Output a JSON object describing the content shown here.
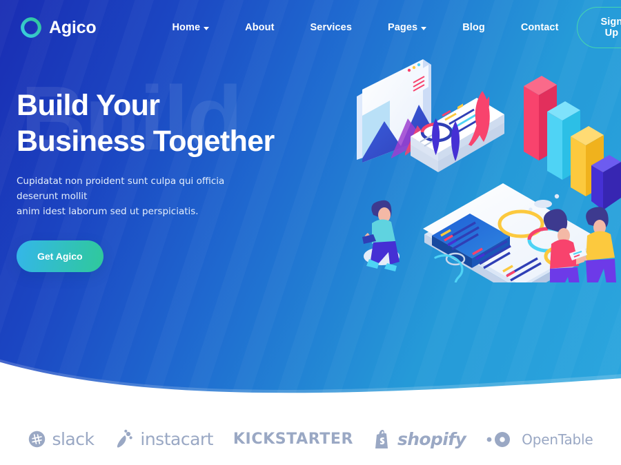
{
  "brand": {
    "name": "Agico",
    "logo_icon": "agico-ring-logo",
    "gradient_from": "#37c0e8",
    "gradient_to": "#2fc98e"
  },
  "nav": {
    "items": [
      {
        "label": "Home",
        "has_dropdown": true,
        "icon": "chevron-down-icon"
      },
      {
        "label": "About",
        "has_dropdown": false,
        "icon": ""
      },
      {
        "label": "Services",
        "has_dropdown": false,
        "icon": ""
      },
      {
        "label": "Pages",
        "has_dropdown": true,
        "icon": "chevron-down-icon"
      },
      {
        "label": "Blog",
        "has_dropdown": false,
        "icon": ""
      },
      {
        "label": "Contact",
        "has_dropdown": false,
        "icon": ""
      }
    ],
    "signup_label": "Sign Up",
    "signup_border_color": "#45d6ae"
  },
  "hero": {
    "watermark": "Build",
    "title": "Build Your\nBusiness Together",
    "subtitle": "Cupidatat non proident sunt culpa qui officia deserunt mollit\nanim idest laborum sed ut perspiciatis.",
    "cta_label": "Get Agico",
    "cta_gradient_from": "#34b6ea",
    "cta_gradient_to": "#2fc99a",
    "bg_gradient_from": "#1a2db3",
    "bg_gradient_to": "#2ba6de",
    "illustration": "isometric-business-analytics-illustration"
  },
  "logos": [
    {
      "name": "slack",
      "icon": "slack-icon",
      "word": "slack"
    },
    {
      "name": "instacart",
      "icon": "instacart-carrot-icon",
      "word": "instacart"
    },
    {
      "name": "kickstarter",
      "icon": "",
      "word": "KICKSTARTER"
    },
    {
      "name": "shopify",
      "icon": "shopify-bag-icon",
      "word": "shopify"
    },
    {
      "name": "opentable",
      "icon": "opentable-dot-icon",
      "word": "OpenTable"
    }
  ],
  "colors": {
    "logo_strip_gray": "#9aa8c4",
    "illustration": {
      "pink": "#f8436d",
      "cyan": "#4fd3f5",
      "yellow": "#fcc93e",
      "purple": "#4530d4",
      "indigo": "#3b3fd0",
      "white": "#ffffff"
    }
  }
}
